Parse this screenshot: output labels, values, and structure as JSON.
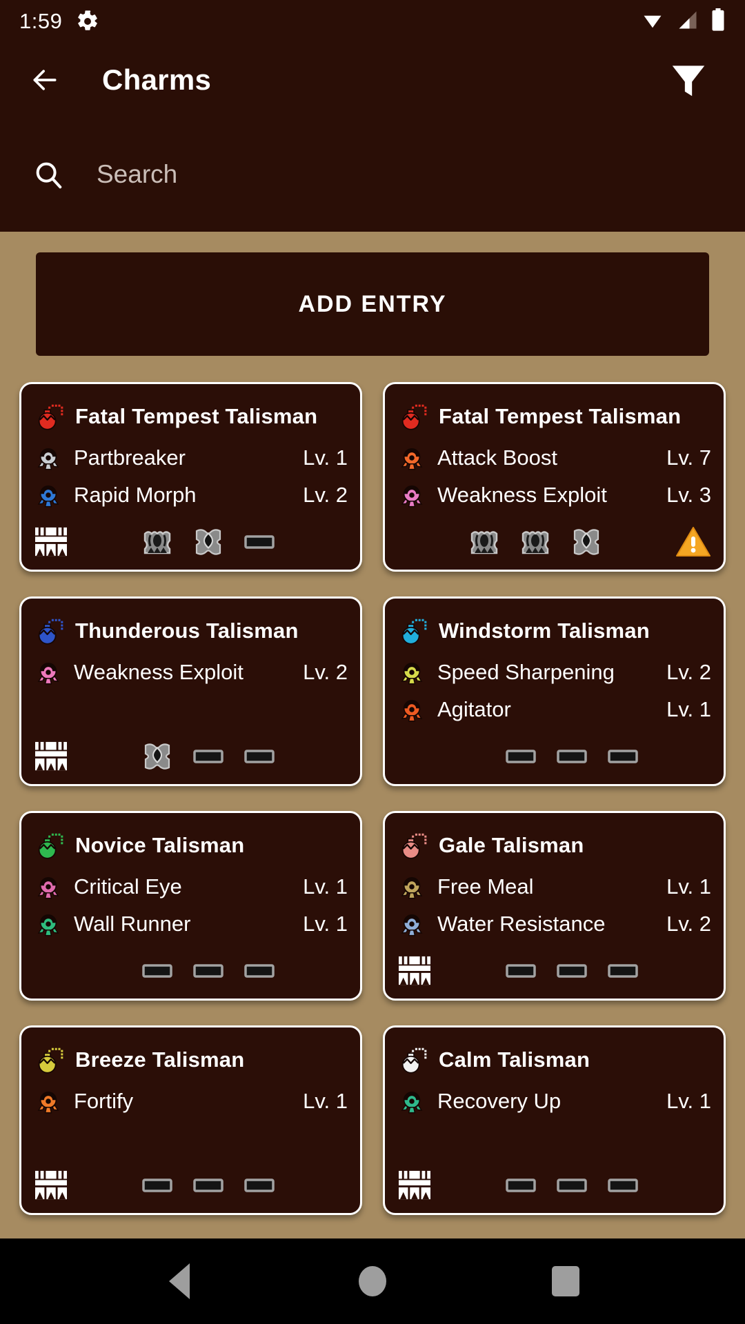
{
  "statusbar": {
    "time": "1:59",
    "icons": [
      "gear-icon",
      "wifi-icon",
      "cell-signal-icon",
      "battery-icon"
    ]
  },
  "appbar": {
    "back_label": "back-arrow",
    "title": "Charms",
    "filter_label": "filter-funnel"
  },
  "search": {
    "placeholder": "Search",
    "value": ""
  },
  "main": {
    "add_entry_label": "ADD ENTRY"
  },
  "colors": {
    "app_bar": "#2A0E06",
    "page_background": "#A68B61",
    "card_background": "#2B0E07",
    "card_border": "#FFFFFF",
    "text": "#FFFFFF",
    "warning": "#F5A623"
  },
  "cards": [
    {
      "title": "Fatal Tempest Talisman",
      "charm_color": "#E02B20",
      "skills": [
        {
          "name": "Partbreaker",
          "level": "Lv. 1",
          "color": "#C9CDD2"
        },
        {
          "name": "Rapid Morph",
          "level": "Lv. 2",
          "color": "#2E78D6"
        }
      ],
      "rarity": true,
      "slots": [
        "level3",
        "level2",
        "empty"
      ],
      "warning": false
    },
    {
      "title": "Fatal Tempest Talisman",
      "charm_color": "#E02B20",
      "skills": [
        {
          "name": "Attack Boost",
          "level": "Lv. 7",
          "color": "#F2682A"
        },
        {
          "name": "Weakness Exploit",
          "level": "Lv. 3",
          "color": "#E87BC4"
        }
      ],
      "rarity": false,
      "slots": [
        "level3",
        "level3",
        "level2"
      ],
      "warning": true
    },
    {
      "title": "Thunderous Talisman",
      "charm_color": "#2E54C8",
      "skills": [
        {
          "name": "Weakness Exploit",
          "level": "Lv. 2",
          "color": "#EE79BC"
        }
      ],
      "rarity": true,
      "slots": [
        "level2",
        "empty",
        "empty"
      ],
      "warning": false
    },
    {
      "title": "Windstorm Talisman",
      "charm_color": "#21AEDC",
      "skills": [
        {
          "name": "Speed Sharpening",
          "level": "Lv. 2",
          "color": "#D6DB4A"
        },
        {
          "name": "Agitator",
          "level": "Lv. 1",
          "color": "#EE5A22"
        }
      ],
      "rarity": false,
      "slots": [
        "empty",
        "empty",
        "empty"
      ],
      "warning": false
    },
    {
      "title": "Novice Talisman",
      "charm_color": "#2FB94F",
      "skills": [
        {
          "name": "Critical Eye",
          "level": "Lv. 1",
          "color": "#E06BAE"
        },
        {
          "name": "Wall Runner",
          "level": "Lv. 1",
          "color": "#2EBD7E"
        }
      ],
      "rarity": false,
      "slots": [
        "empty",
        "empty",
        "empty"
      ],
      "warning": false
    },
    {
      "title": "Gale Talisman",
      "charm_color": "#E98C86",
      "skills": [
        {
          "name": "Free Meal",
          "level": "Lv. 1",
          "color": "#BFA45C"
        },
        {
          "name": "Water Resistance",
          "level": "Lv. 2",
          "color": "#8FAED8"
        }
      ],
      "rarity": true,
      "slots": [
        "empty",
        "empty",
        "empty"
      ],
      "warning": false
    },
    {
      "title": "Breeze Talisman",
      "charm_color": "#D6CB3C",
      "skills": [
        {
          "name": "Fortify",
          "level": "Lv. 1",
          "color": "#F07A28"
        }
      ],
      "rarity": true,
      "slots": [
        "empty",
        "empty",
        "empty"
      ],
      "warning": false
    },
    {
      "title": "Calm Talisman",
      "charm_color": "#F2F2F2",
      "skills": [
        {
          "name": "Recovery Up",
          "level": "Lv. 1",
          "color": "#2FB98C"
        }
      ],
      "rarity": true,
      "slots": [
        "empty",
        "empty",
        "empty"
      ],
      "warning": false
    }
  ],
  "navbar": {
    "back": "triangle-back-icon",
    "home": "circle-home-icon",
    "recents": "square-recents-icon"
  }
}
